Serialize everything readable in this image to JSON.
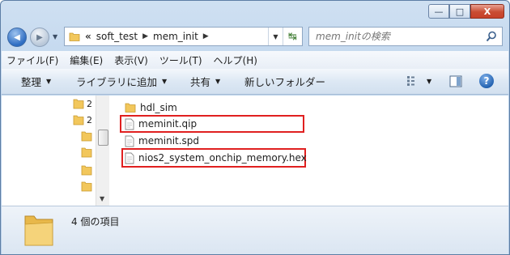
{
  "window": {
    "caption_minimize": "—",
    "caption_maximize": "□",
    "caption_close": "X"
  },
  "nav": {
    "back_glyph": "◀",
    "forward_glyph": "▶",
    "dropdown_glyph": "▼"
  },
  "address": {
    "overflow": "«",
    "crumbs": [
      "soft_test",
      "mem_init"
    ],
    "separator": "▶",
    "refresh_glyph": "↹"
  },
  "search": {
    "placeholder": "mem_initの検索"
  },
  "menu": {
    "items": [
      "ファイル(F)",
      "編集(E)",
      "表示(V)",
      "ツール(T)",
      "ヘルプ(H)"
    ]
  },
  "toolbar": {
    "organize": "整理",
    "add_to_library": "ライブラリに追加",
    "share": "共有",
    "new_folder": "新しいフォルダー",
    "help_glyph": "?"
  },
  "navpane": {
    "items": [
      "2",
      "2"
    ]
  },
  "files": [
    {
      "name": "hdl_sim",
      "type": "folder",
      "highlighted": false
    },
    {
      "name": "meminit.qip",
      "type": "file",
      "highlighted": true
    },
    {
      "name": "meminit.spd",
      "type": "file",
      "highlighted": false
    },
    {
      "name": "nios2_system_onchip_memory.hex",
      "type": "file",
      "highlighted": true
    }
  ],
  "details": {
    "item_count": "4 個の項目"
  },
  "colors": {
    "highlight": "#e02020",
    "folder": "#f2c75c"
  }
}
